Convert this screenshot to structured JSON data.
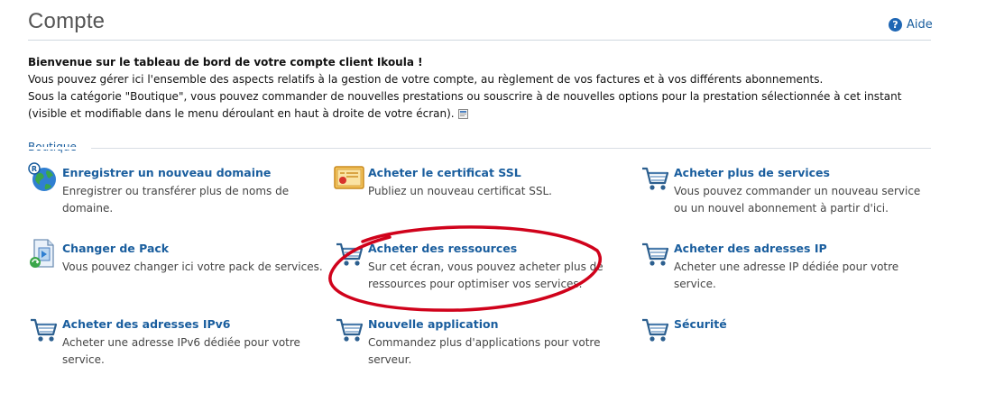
{
  "header": {
    "title": "Compte",
    "help_label": "Aide",
    "help_icon": "question-circle-icon"
  },
  "intro": {
    "welcome": "Bienvenue sur le tableau de bord de votre compte client Ikoula !",
    "line1": "Vous pouvez gérer ici l'ensemble des aspects relatifs à la gestion de votre compte, au règlement de vos factures et à vos différents abonnements.",
    "line2": "Sous la catégorie \"Boutique\", vous pouvez commander de nouvelles prestations ou souscrire à de nouvelles options pour la prestation sélectionnée à cet instant (visible et modifiable dans le menu déroulant en haut à droite de votre écran).",
    "icon": "dropdown-menu-icon"
  },
  "section": {
    "title": "Boutique"
  },
  "tiles": [
    {
      "title": "Enregistrer un nouveau domaine",
      "desc": "Enregistrer ou transférer plus de noms de domaine.",
      "icon": "globe-registered-icon"
    },
    {
      "title": "Acheter le certificat SSL",
      "desc": "Publiez un nouveau certificat SSL.",
      "icon": "certificate-icon"
    },
    {
      "title": "Acheter plus de services",
      "desc": "Vous pouvez commander un nouveau service ou un nouvel abonnement à partir d'ici.",
      "icon": "shopping-cart-icon"
    },
    {
      "title": "Changer de Pack",
      "desc": "Vous pouvez changer ici votre pack de services.",
      "icon": "change-pack-icon"
    },
    {
      "title": "Acheter des ressources",
      "desc": "Sur cet écran, vous pouvez acheter plus de ressources pour optimiser vos services.",
      "icon": "shopping-cart-icon"
    },
    {
      "title": "Acheter des adresses IP",
      "desc": "Acheter une adresse IP dédiée pour votre service.",
      "icon": "shopping-cart-icon"
    },
    {
      "title": "Acheter des adresses IPv6",
      "desc": "Acheter une adresse IPv6 dédiée pour votre service.",
      "icon": "shopping-cart-icon"
    },
    {
      "title": "Nouvelle application",
      "desc": "Commandez plus d'applications pour votre serveur.",
      "icon": "shopping-cart-icon"
    },
    {
      "title": "Sécurité",
      "desc": "",
      "icon": "shopping-cart-icon"
    }
  ],
  "colors": {
    "link": "#1a5e9e",
    "highlight_annotation": "#d0021b"
  }
}
